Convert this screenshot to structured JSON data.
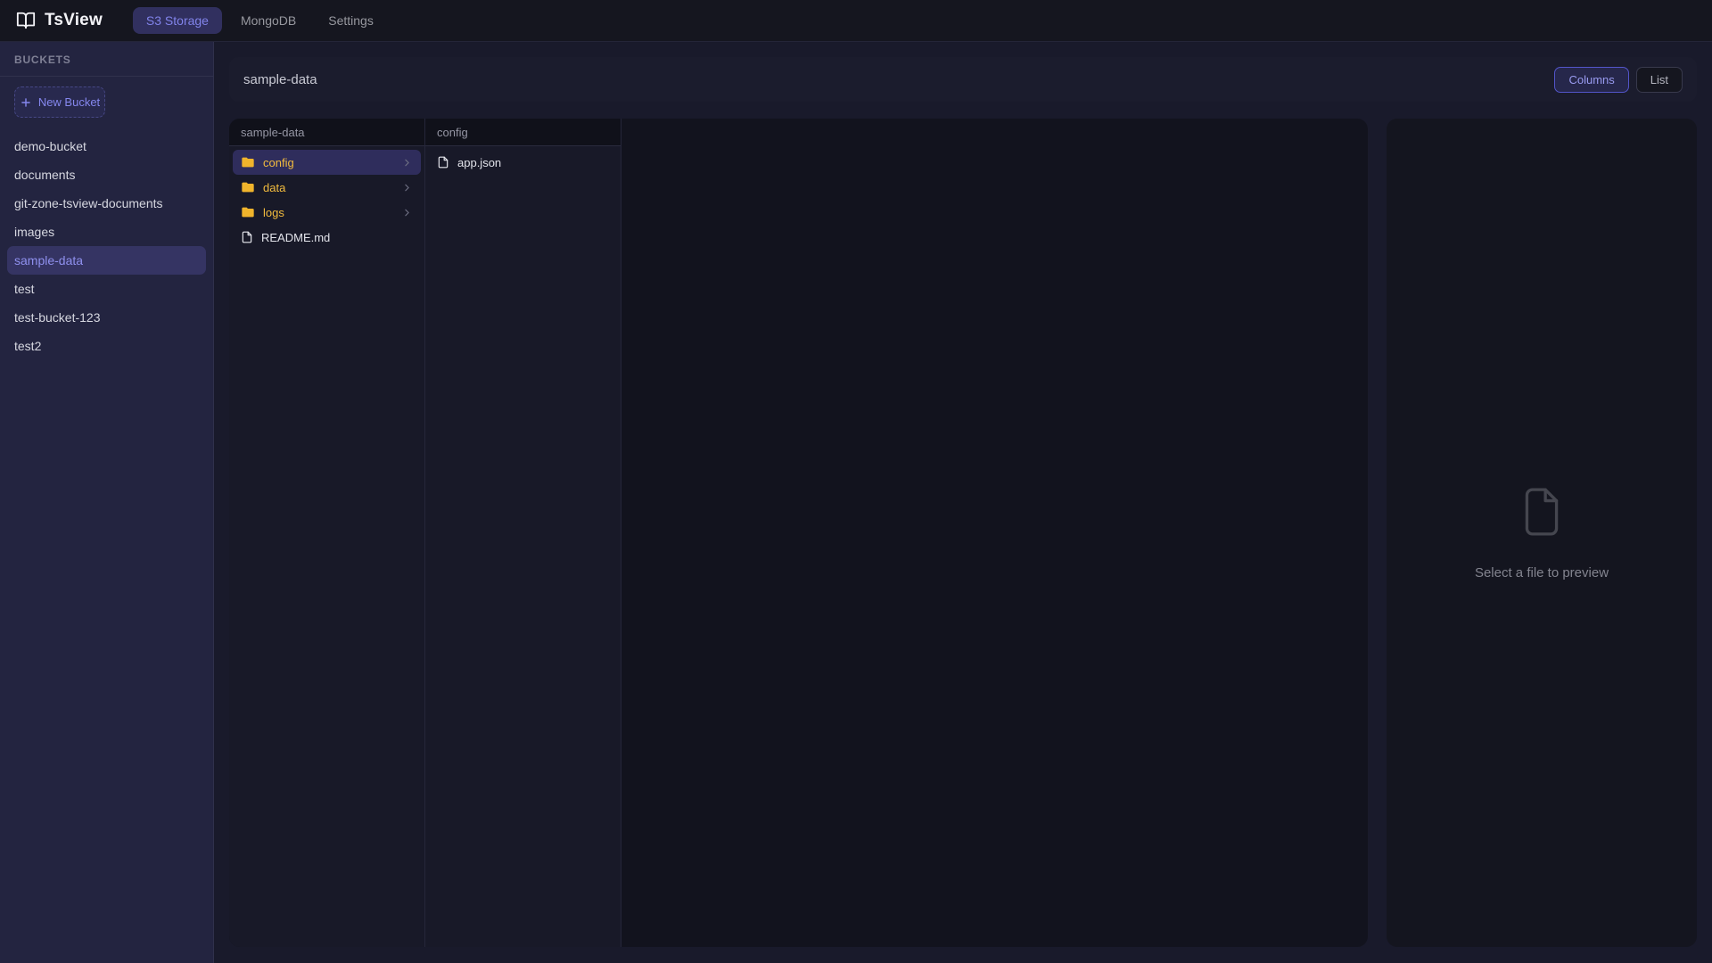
{
  "colors": {
    "accent": "#8183ea",
    "accent_border": "#5355c9",
    "folder": "#f0b42c",
    "selection_bg": "#2f2d5c",
    "sidebar_selection_bg": "#353463"
  },
  "navbar": {
    "brand": "TsView",
    "tabs": [
      {
        "label": "S3 Storage",
        "active": true
      },
      {
        "label": "MongoDB",
        "active": false
      },
      {
        "label": "Settings",
        "active": false
      }
    ]
  },
  "sidebar": {
    "section_label": "BUCKETS",
    "new_bucket_label": "New Bucket",
    "selected_bucket": "sample-data",
    "buckets": [
      "demo-bucket",
      "documents",
      "git-zone-tsview-documents",
      "images",
      "sample-data",
      "test",
      "test-bucket-123",
      "test2"
    ]
  },
  "header": {
    "title": "sample-data",
    "view_buttons": [
      {
        "label": "Columns",
        "active": true
      },
      {
        "label": "List",
        "active": false
      }
    ]
  },
  "browser": {
    "columns": [
      {
        "title": "sample-data",
        "items": [
          {
            "name": "config",
            "type": "folder",
            "selected": true,
            "has_children": true
          },
          {
            "name": "data",
            "type": "folder",
            "selected": false,
            "has_children": true
          },
          {
            "name": "logs",
            "type": "folder",
            "selected": false,
            "has_children": true
          },
          {
            "name": "README.md",
            "type": "file",
            "selected": false,
            "has_children": false
          }
        ]
      },
      {
        "title": "config",
        "items": [
          {
            "name": "app.json",
            "type": "file",
            "selected": false,
            "has_children": false
          }
        ]
      }
    ]
  },
  "preview": {
    "placeholder": "Select a file to preview"
  }
}
